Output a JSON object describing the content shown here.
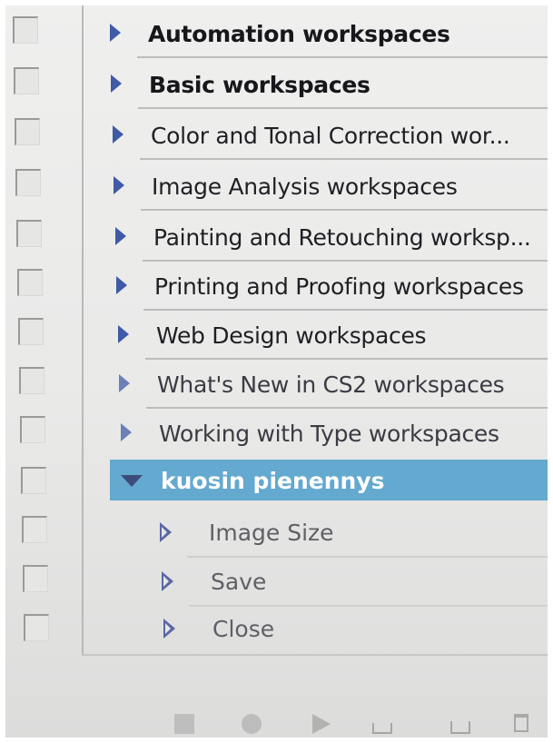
{
  "panel": {
    "items": [
      {
        "label": "Automation workspaces",
        "style": "bold"
      },
      {
        "label": "Basic workspaces",
        "style": "bold"
      },
      {
        "label": "Color and Tonal Correction wor...",
        "style": "regular"
      },
      {
        "label": "Image Analysis workspaces",
        "style": "regular"
      },
      {
        "label": "Painting and Retouching worksp...",
        "style": "regular"
      },
      {
        "label": "Printing and Proofing workspaces",
        "style": "regular"
      },
      {
        "label": "Web Design workspaces",
        "style": "regular"
      },
      {
        "label": "What's New in CS2 workspaces",
        "style": "faded"
      },
      {
        "label": "Working with Type workspaces",
        "style": "faded"
      }
    ],
    "selected_set": {
      "label": "kuosin pienennys",
      "expanded": true
    },
    "actions": [
      {
        "label": "Image Size"
      },
      {
        "label": "Save"
      },
      {
        "label": "Close"
      }
    ]
  },
  "toolbar": {
    "buttons": [
      {
        "icon": "stop-icon"
      },
      {
        "icon": "record-icon"
      },
      {
        "icon": "play-icon"
      },
      {
        "icon": "new-set-icon"
      },
      {
        "icon": "new-action-icon"
      },
      {
        "icon": "trash-icon"
      }
    ]
  },
  "colors": {
    "selection": "#64a9cf",
    "triangle": "#3f5aa6",
    "panel_bg": "#e9e9e8"
  }
}
